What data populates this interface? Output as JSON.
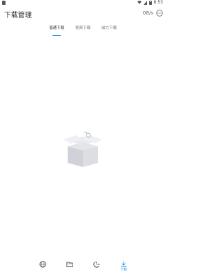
{
  "statusbar": {
    "time": "8:53"
  },
  "header": {
    "title": "下载管理",
    "speed": "0B/s"
  },
  "tabs": [
    {
      "label": "普通下载",
      "active": true
    },
    {
      "label": "视频下载",
      "active": false
    },
    {
      "label": "磁力下载",
      "active": false
    }
  ],
  "bottom_nav": {
    "items": [
      {
        "icon": "globe-icon"
      },
      {
        "icon": "folder-icon"
      },
      {
        "icon": "magnet-icon"
      },
      {
        "icon": "download-icon",
        "label": "下载",
        "active": true
      }
    ]
  },
  "colors": {
    "accent": "#2196f3",
    "box": "#dcdee3"
  }
}
